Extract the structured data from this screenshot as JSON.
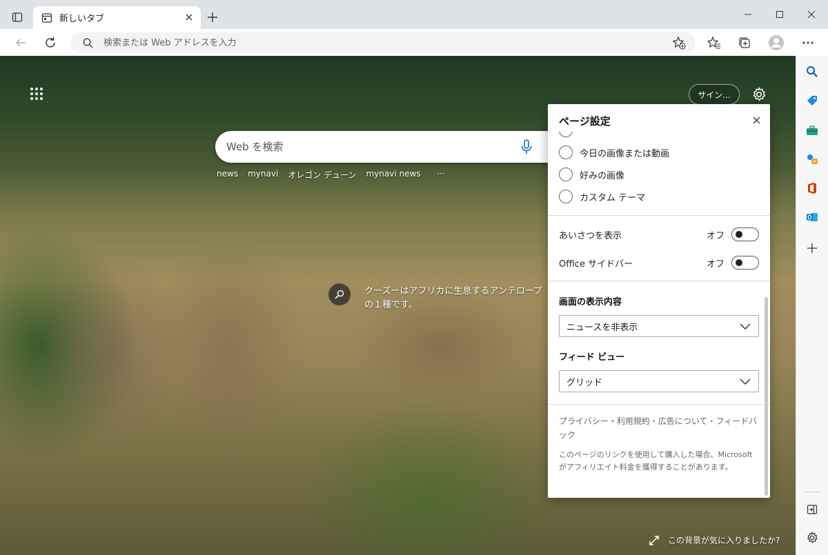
{
  "tab": {
    "title": "新しいタブ"
  },
  "address_bar": {
    "placeholder": "検索または Web アドレスを入力"
  },
  "new_tab_page": {
    "signin_label": "サイン...",
    "search_placeholder": "Web を検索",
    "trending": [
      "news",
      "mynavi",
      "オレゴン デューン",
      "mynavi news",
      "···"
    ],
    "image_caption": "クーズーはアフリカに生息するアンテロープの１種です。",
    "like_background": "この背景が気に入りましたか?"
  },
  "page_settings": {
    "title": "ページ設定",
    "background_options": [
      "今日の画像または動画",
      "好みの画像",
      "カスタム テーマ"
    ],
    "toggles": [
      {
        "label": "あいさつを表示",
        "state": "オフ"
      },
      {
        "label": "Office サイドバー",
        "state": "オフ"
      }
    ],
    "content_section": {
      "title": "画面の表示内容",
      "selected": "ニュースを非表示"
    },
    "feed_section": {
      "title": "フィード ビュー",
      "selected": "グリッド"
    },
    "footer_links": "プライバシー・利用規約・広告について・フィードバック",
    "footer_note": "このページのリンクを使用して購入した場合、Microsoft がアフィリエイト料金を獲得することがあります。"
  },
  "sidebar_icons": [
    "search-icon",
    "tag-icon",
    "toolbox-icon",
    "games-icon",
    "office-icon",
    "outlook-icon",
    "plus-icon",
    "hide-sidebar-icon",
    "settings-icon"
  ],
  "colors": {
    "accent": "#0f6cbd",
    "office": "#d83b01",
    "outlook": "#0078d4"
  }
}
